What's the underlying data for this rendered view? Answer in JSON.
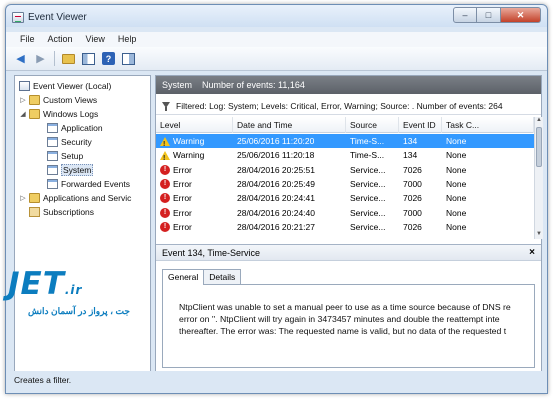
{
  "window": {
    "title": "Event Viewer"
  },
  "menu": [
    "File",
    "Action",
    "View",
    "Help"
  ],
  "tree": {
    "root": "Event Viewer (Local)",
    "custom_views": "Custom Views",
    "windows_logs": "Windows Logs",
    "logs": [
      "Application",
      "Security",
      "Setup",
      "System",
      "Forwarded Events"
    ],
    "apps_services": "Applications and Servic",
    "subscriptions": "Subscriptions"
  },
  "panel": {
    "header": "System    Number of events: 11,164",
    "filter": "Filtered: Log: System; Levels: Critical, Error, Warning; Source: . Number of events: 264"
  },
  "table": {
    "columns": [
      "Level",
      "Date and Time",
      "Source",
      "Event ID",
      "Task C..."
    ],
    "rows": [
      {
        "level": "Warning",
        "icon": "warning",
        "date": "25/06/2016 11:20:20",
        "source": "Time-S...",
        "id": "134",
        "task": "None",
        "selected": true
      },
      {
        "level": "Warning",
        "icon": "warning",
        "date": "25/06/2016 11:20:18",
        "source": "Time-S...",
        "id": "134",
        "task": "None",
        "selected": false
      },
      {
        "level": "Error",
        "icon": "error",
        "date": "28/04/2016 20:25:51",
        "source": "Service...",
        "id": "7026",
        "task": "None",
        "selected": false
      },
      {
        "level": "Error",
        "icon": "error",
        "date": "28/04/2016 20:25:49",
        "source": "Service...",
        "id": "7000",
        "task": "None",
        "selected": false
      },
      {
        "level": "Error",
        "icon": "error",
        "date": "28/04/2016 20:24:41",
        "source": "Service...",
        "id": "7026",
        "task": "None",
        "selected": false
      },
      {
        "level": "Error",
        "icon": "error",
        "date": "28/04/2016 20:24:40",
        "source": "Service...",
        "id": "7000",
        "task": "None",
        "selected": false
      },
      {
        "level": "Error",
        "icon": "error",
        "date": "28/04/2016 20:21:27",
        "source": "Service...",
        "id": "7026",
        "task": "None",
        "selected": false
      }
    ]
  },
  "detail": {
    "title": "Event 134, Time-Service",
    "close": "×",
    "tabs": [
      "General",
      "Details"
    ],
    "lines": [
      "NtpClient was unable to set a manual peer to use as a time source because of DNS re",
      "error on ''. NtpClient will try again in 3473457 minutes and double the reattempt inte",
      "thereafter. The error was: The requested name is valid, but no data of the requested t"
    ]
  },
  "status": "Creates a filter.",
  "watermark": {
    "logo": "JET",
    "suffix": ".ir",
    "tagline": "جت ، پرواز در آسمان دانش"
  },
  "colors": {
    "selection": "#3399ff",
    "header": "#5c6168",
    "brand": "#0c7dbf"
  }
}
